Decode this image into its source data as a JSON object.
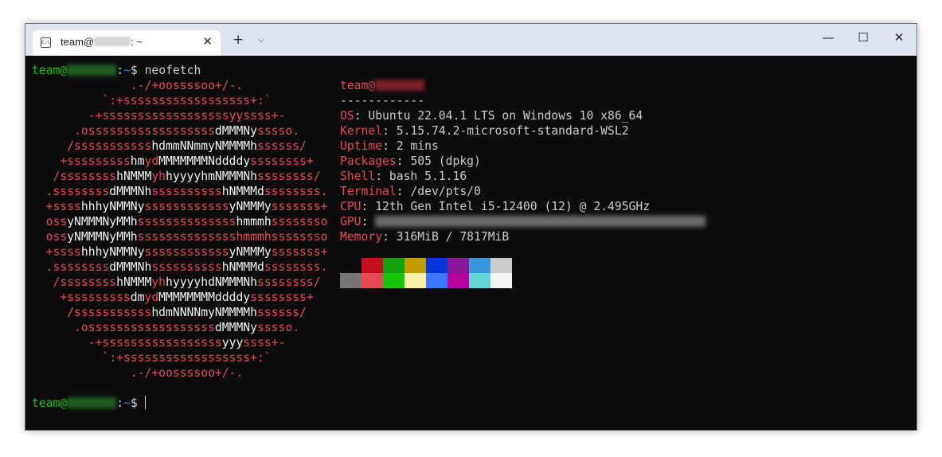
{
  "window": {
    "tab_title_prefix": "team@",
    "tab_title_suffix": ": ~",
    "new_tab_glyph": "+",
    "tab_dropdown_glyph": "⌵",
    "tab_close_glyph": "✕",
    "minimize_glyph": "—",
    "maximize_glyph": "☐",
    "close_glyph": "✕",
    "icon_name": "terminal-icon"
  },
  "prompt": {
    "user": "team@",
    "path_sep": ":",
    "path": "~",
    "symbol": "$",
    "command": " neofetch"
  },
  "ascii_art": [
    [
      {
        "t": "              .-/+oossssoo+/-.",
        "c": "red"
      }
    ],
    [
      {
        "t": "          `:+ssssssssssssssssss+:`",
        "c": "red"
      }
    ],
    [
      {
        "t": "        -+ssssssssssssssssssyyssss+-",
        "c": "red"
      }
    ],
    [
      {
        "t": "      .ossssssssssssssssss",
        "c": "red"
      },
      {
        "t": "dMMMNy",
        "c": "white"
      },
      {
        "t": "sssso.",
        "c": "red"
      }
    ],
    [
      {
        "t": "     /sssssssssss",
        "c": "red"
      },
      {
        "t": "hdmmNNmmyNMMMMh",
        "c": "white"
      },
      {
        "t": "ssssss/",
        "c": "red"
      }
    ],
    [
      {
        "t": "    +sssssssss",
        "c": "red"
      },
      {
        "t": "hm",
        "c": "white"
      },
      {
        "t": "yd",
        "c": "red"
      },
      {
        "t": "MMMMMMMNddddy",
        "c": "white"
      },
      {
        "t": "ssssssss+",
        "c": "red"
      }
    ],
    [
      {
        "t": "   /ssssssss",
        "c": "red"
      },
      {
        "t": "hNMMM",
        "c": "white"
      },
      {
        "t": "yh",
        "c": "red"
      },
      {
        "t": "hyyyyhmNMMMNh",
        "c": "white"
      },
      {
        "t": "ssssssss/",
        "c": "red"
      }
    ],
    [
      {
        "t": "  .ssssssss",
        "c": "red"
      },
      {
        "t": "dMMMNh",
        "c": "white"
      },
      {
        "t": "ssssssssss",
        "c": "red"
      },
      {
        "t": "hNMMMd",
        "c": "white"
      },
      {
        "t": "ssssssss.",
        "c": "red"
      }
    ],
    [
      {
        "t": "  +ssss",
        "c": "red"
      },
      {
        "t": "hhhyNMMNy",
        "c": "white"
      },
      {
        "t": "ssssssssssss",
        "c": "red"
      },
      {
        "t": "yNMMMy",
        "c": "white"
      },
      {
        "t": "sssssss+",
        "c": "red"
      }
    ],
    [
      {
        "t": "  oss",
        "c": "red"
      },
      {
        "t": "yNMMMNyMMh",
        "c": "white"
      },
      {
        "t": "ssssssssssssss",
        "c": "red"
      },
      {
        "t": "hmmmh",
        "c": "white"
      },
      {
        "t": "ssssssso",
        "c": "red"
      }
    ],
    [
      {
        "t": "  oss",
        "c": "red"
      },
      {
        "t": "yNMMMNyMMh",
        "c": "white"
      },
      {
        "t": "sssssssssssssshmmmhssssssso",
        "c": "red"
      }
    ],
    [
      {
        "t": "  +ssss",
        "c": "red"
      },
      {
        "t": "hhhyNMMNy",
        "c": "white"
      },
      {
        "t": "ssssssssssss",
        "c": "red"
      },
      {
        "t": "yNMMMy",
        "c": "white"
      },
      {
        "t": "sssssss+",
        "c": "red"
      }
    ],
    [
      {
        "t": "  .ssssssss",
        "c": "red"
      },
      {
        "t": "dMMMNh",
        "c": "white"
      },
      {
        "t": "ssssssssss",
        "c": "red"
      },
      {
        "t": "hNMMMd",
        "c": "white"
      },
      {
        "t": "ssssssss.",
        "c": "red"
      }
    ],
    [
      {
        "t": "   /ssssssss",
        "c": "red"
      },
      {
        "t": "hNMMM",
        "c": "white"
      },
      {
        "t": "yh",
        "c": "red"
      },
      {
        "t": "hyyyyhdNMMMNh",
        "c": "white"
      },
      {
        "t": "ssssssss/",
        "c": "red"
      }
    ],
    [
      {
        "t": "    +sssssssss",
        "c": "red"
      },
      {
        "t": "dm",
        "c": "white"
      },
      {
        "t": "yd",
        "c": "red"
      },
      {
        "t": "MMMMMMMMddddy",
        "c": "white"
      },
      {
        "t": "ssssssss+",
        "c": "red"
      }
    ],
    [
      {
        "t": "     /sssssssssss",
        "c": "red"
      },
      {
        "t": "hdmNNNNmyNMMMMh",
        "c": "white"
      },
      {
        "t": "ssssss/",
        "c": "red"
      }
    ],
    [
      {
        "t": "      .ossssssssssssssssss",
        "c": "red"
      },
      {
        "t": "dMMMNy",
        "c": "white"
      },
      {
        "t": "sssso.",
        "c": "red"
      }
    ],
    [
      {
        "t": "        -+sssssssssssssssss",
        "c": "red"
      },
      {
        "t": "yyy",
        "c": "white"
      },
      {
        "t": "ssss+-",
        "c": "red"
      }
    ],
    [
      {
        "t": "          `:+ssssssssssssssssss+:`",
        "c": "red"
      }
    ],
    [
      {
        "t": "              .-/+oossssoo+/-.",
        "c": "red"
      }
    ]
  ],
  "info": {
    "header_user": "team@",
    "separator": "------------",
    "fields": [
      {
        "key": "OS",
        "value": "Ubuntu 22.04.1 LTS on Windows 10 x86_64"
      },
      {
        "key": "Kernel",
        "value": "5.15.74.2-microsoft-standard-WSL2"
      },
      {
        "key": "Uptime",
        "value": "2 mins"
      },
      {
        "key": "Packages",
        "value": "505 (dpkg)"
      },
      {
        "key": "Shell",
        "value": "bash 5.1.16"
      },
      {
        "key": "Terminal",
        "value": "/dev/pts/0"
      },
      {
        "key": "CPU",
        "value": "12th Gen Intel i5-12400 (12) @ 2.495GHz"
      },
      {
        "key": "GPU",
        "value": ""
      },
      {
        "key": "Memory",
        "value": "316MiB / 7817MiB"
      }
    ]
  },
  "colors": {
    "red": "#e74856",
    "white": "#f2f2f2",
    "green": "#16c60c",
    "blue": "#3b78ff",
    "text": "#cccccc",
    "background": "#0c0c0c"
  },
  "palette": {
    "row1": [
      "#0c0c0c",
      "#c50f1f",
      "#13a10e",
      "#c19c00",
      "#0037da",
      "#881798",
      "#3a96dd",
      "#cccccc"
    ],
    "row2": [
      "#767676",
      "#e74856",
      "#16c60c",
      "#f9f1a5",
      "#3b78ff",
      "#b4009e",
      "#61d6d6",
      "#f2f2f2"
    ]
  }
}
